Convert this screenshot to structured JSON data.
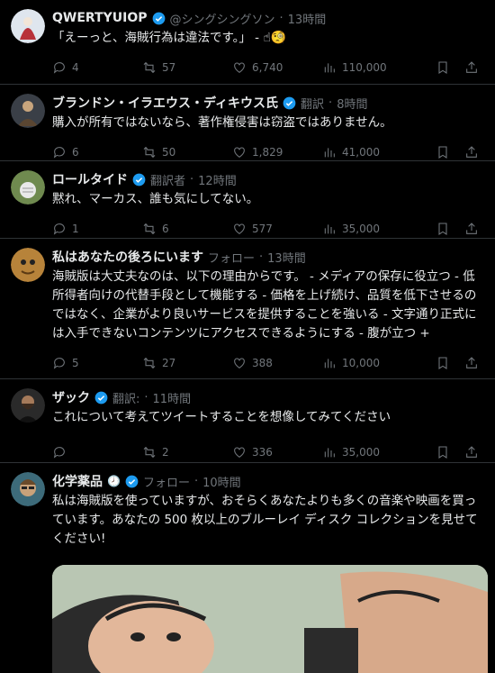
{
  "tweets": [
    {
      "name": "QWERTYUIOP",
      "handle": "@シングシングソン",
      "time": "13時間",
      "text": "「えーっと、海賊行為は違法です。」 -",
      "emoji": "☝🧐",
      "replies": "4",
      "retweets": "57",
      "likes": "6,740",
      "views": "110,000",
      "avatar_color": "#dfe6ee"
    },
    {
      "name": "ブランドン・イラエウス・ディキウス氏",
      "meta": "翻訳",
      "time": "8時間",
      "text": "購入が所有ではないなら、著作権侵害は窃盗ではありません。",
      "replies": "6",
      "retweets": "50",
      "likes": "1,829",
      "views": "41,000",
      "avatar_color": "#3a3f47"
    },
    {
      "name": "ロールタイド",
      "meta": "翻訳者",
      "time": "12時間",
      "text": "黙れ、マーカス、誰も気にしてない。",
      "replies": "1",
      "retweets": "6",
      "likes": "577",
      "views": "35,000",
      "avatar_color": "#6f8a4f"
    },
    {
      "name": "私はあなたの後ろにいます",
      "meta": "フォロー",
      "time": "13時間",
      "text": "海賊版は大丈夫なのは、以下の理由からです。 - メディアの保存に役立つ - 低所得者向けの代替手段として機能する - 価格を上げ続け、品質を低下させるのではなく、企業がより良いサービスを提供することを強いる - 文字通り正式には入手できないコンテンツにアクセスできるようにする - 腹が立つ +",
      "replies": "5",
      "retweets": "27",
      "likes": "388",
      "views": "10,000",
      "avatar_color": "#b7833a"
    },
    {
      "name": "ザック",
      "meta": "翻訳:",
      "time": "11時間",
      "text": "これについて考えてツイートすることを想像してみてください",
      "replies": "",
      "retweets": "2",
      "likes": "336",
      "views": "35,000",
      "avatar_color": "#2a2a2a"
    },
    {
      "name": "化学薬品",
      "name_icon": "🕗",
      "meta": "フォロー",
      "time": "10時間",
      "text": "私は海賊版を使っていますが、おそらくあなたよりも多くの音楽や映画を買っています。あなたの 500 枚以上のブルーレイ ディスク コレクションを見せてください!",
      "avatar_color": "#c9a27a"
    }
  ],
  "separator": "·",
  "colors": {
    "accent": "#1d9bf0",
    "muted": "#71767b",
    "text": "#e7e9ea",
    "border": "#2f3336"
  },
  "icons": [
    "reply-icon",
    "retweet-icon",
    "like-icon",
    "views-icon",
    "bookmark-icon",
    "share-icon",
    "verified-icon",
    "clock-icon"
  ]
}
